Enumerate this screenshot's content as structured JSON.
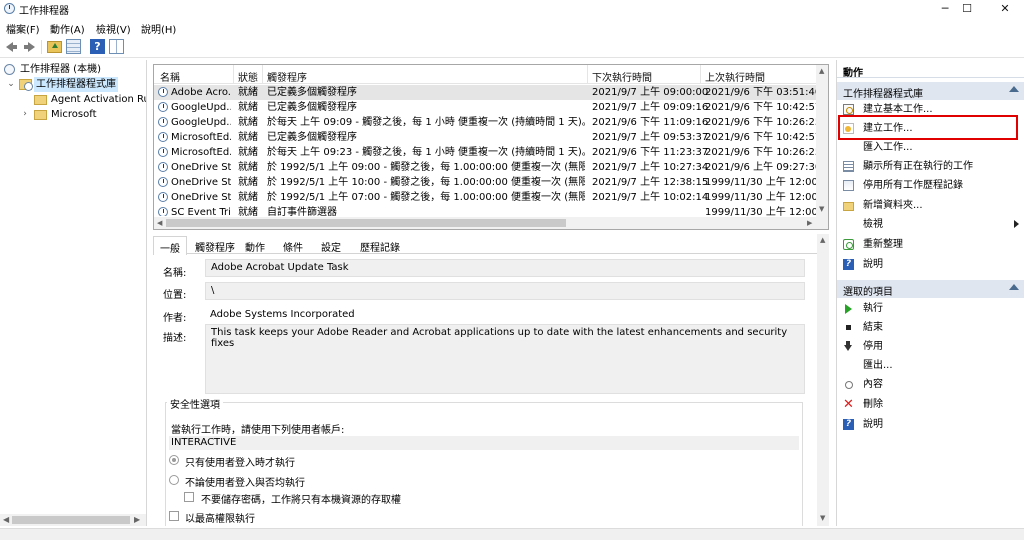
{
  "window": {
    "title": "工作排程器",
    "min": "─",
    "max": "☐",
    "close": "✕"
  },
  "menu": [
    "檔案(F)",
    "動作(A)",
    "檢視(V)",
    "說明(H)"
  ],
  "tree": {
    "root": "工作排程器 (本機)",
    "library": "工作排程器程式庫",
    "children": [
      "Agent Activation Runtime",
      "Microsoft"
    ]
  },
  "list": {
    "columns": [
      "名稱",
      "狀態",
      "觸發程序",
      "下次執行時間",
      "上次執行時間"
    ],
    "rows": [
      {
        "name": "Adobe Acro...",
        "status": "就緒",
        "trigger": "已定義多個觸發程序",
        "next": "2021/9/7 上午 09:00:00",
        "last": "2021/9/6 下午 03:51:40"
      },
      {
        "name": "GoogleUpd...",
        "status": "就緒",
        "trigger": "已定義多個觸發程序",
        "next": "2021/9/7 上午 09:09:16",
        "last": "2021/9/6 下午 10:42:57"
      },
      {
        "name": "GoogleUpd...",
        "status": "就緒",
        "trigger": "於每天 上午 09:09 - 觸發之後，每 1 小時 便重複一次 (持續時間 1 天)。",
        "next": "2021/9/6 下午 11:09:16",
        "last": "2021/9/6 下午 10:26:25"
      },
      {
        "name": "MicrosoftEd...",
        "status": "就緒",
        "trigger": "已定義多個觸發程序",
        "next": "2021/9/7 上午 09:53:37",
        "last": "2021/9/6 下午 10:42:57"
      },
      {
        "name": "MicrosoftEd...",
        "status": "就緒",
        "trigger": "於每天 上午 09:23 - 觸發之後，每 1 小時 便重複一次 (持續時間 1 天)。",
        "next": "2021/9/6 下午 11:23:37",
        "last": "2021/9/6 下午 10:26:25"
      },
      {
        "name": "OneDrive St...",
        "status": "就緒",
        "trigger": "於 1992/5/1 上午 09:00 - 觸發之後，每 1.00:00:00 便重複一次 (無限期)。",
        "next": "2021/9/7 上午 10:27:34",
        "last": "2021/9/6 上午 09:27:30"
      },
      {
        "name": "OneDrive St...",
        "status": "就緒",
        "trigger": "於 1992/5/1 上午 10:00 - 觸發之後，每 1.00:00:00 便重複一次 (無限期)。",
        "next": "2021/9/7 上午 12:38:15",
        "last": "1999/11/30 上午 12:00:0"
      },
      {
        "name": "OneDrive St...",
        "status": "就緒",
        "trigger": "於 1992/5/1 上午 07:00 - 觸發之後，每 1.00:00:00 便重複一次 (無限期)。",
        "next": "2021/9/7 上午 10:02:14",
        "last": "1999/11/30 上午 12:00:0"
      },
      {
        "name": "SC Event Tri...",
        "status": "就緒",
        "trigger": "自訂事件篩選器",
        "next": "",
        "last": "1999/11/30 上午 12:00:0"
      }
    ]
  },
  "detail": {
    "tabs": [
      "一般",
      "觸發程序",
      "動作",
      "條件",
      "設定",
      "歷程記錄"
    ],
    "name_label": "名稱:",
    "name_value": "Adobe Acrobat Update Task",
    "location_label": "位置:",
    "location_value": "\\",
    "author_label": "作者:",
    "author_value": "Adobe Systems Incorporated",
    "desc_label": "描述:",
    "desc_value": "This task keeps your Adobe Reader and Acrobat applications up to date with the latest enhancements and security fixes",
    "security_title": "安全性選項",
    "run_as_text": "當執行工作時，請使用下列使用者帳戶:",
    "account": "INTERACTIVE",
    "opt_logged_on": "只有使用者登入時才執行",
    "opt_whether": "不論使用者登入與否均執行",
    "opt_no_store": "不要儲存密碼，工作將只有本機資源的存取權",
    "opt_highest": "以最高權限執行"
  },
  "actions": {
    "title": "動作",
    "section1": "工作排程器程式庫",
    "items1": [
      "建立基本工作...",
      "建立工作...",
      "匯入工作...",
      "顯示所有正在執行的工作",
      "停用所有工作歷程記錄",
      "新增資料夾...",
      "檢視",
      "重新整理",
      "說明"
    ],
    "section2": "選取的項目",
    "items2": [
      "執行",
      "結束",
      "停用",
      "匯出...",
      "內容",
      "刪除",
      "說明"
    ]
  }
}
